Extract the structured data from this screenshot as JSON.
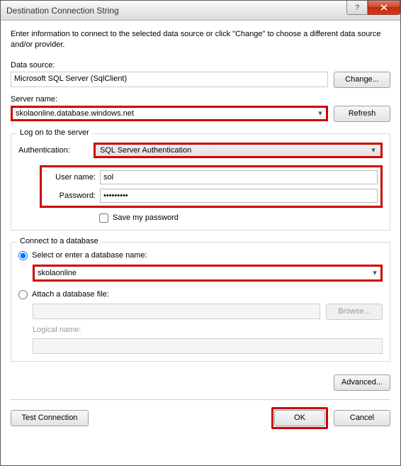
{
  "window": {
    "title": "Destination Connection String"
  },
  "desc": "Enter information to connect to the selected data source or click \"Change\" to choose a different data source and/or provider.",
  "data_source": {
    "label": "Data source:",
    "value": "Microsoft SQL Server (SqlClient)",
    "change_btn": "Change..."
  },
  "server": {
    "label": "Server name:",
    "value": "skolaonline.database.windows.net",
    "refresh_btn": "Refresh"
  },
  "logon": {
    "group": "Log on to the server",
    "auth_label": "Authentication:",
    "auth_value": "SQL Server Authentication",
    "user_label": "User name:",
    "user_value": "sol",
    "pass_label": "Password:",
    "pass_value": "•••••••••",
    "save_pw": "Save my password"
  },
  "connect": {
    "group": "Connect to a database",
    "radio_select": "Select or enter a database name:",
    "db_value": "skolaonline",
    "radio_attach": "Attach a database file:",
    "browse_btn": "Browse...",
    "logical_label": "Logical name:"
  },
  "advanced_btn": "Advanced...",
  "footer": {
    "test_btn": "Test Connection",
    "ok_btn": "OK",
    "cancel_btn": "Cancel"
  }
}
